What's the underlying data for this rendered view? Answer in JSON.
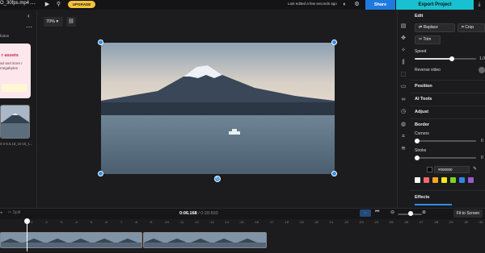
{
  "topbar": {
    "filename": "O_30fps.mp4",
    "more_icon": "ellipsis-icon",
    "upgrade_label": "UPGRADE",
    "last_edited": "Last edited a few seconds ago",
    "share_label": "Share",
    "export_label": "Export Project"
  },
  "left_panel": {
    "photos_label": "hotos",
    "promo": {
      "title": "r assets",
      "text": "ad and store r megabytes"
    },
    "thumb_caption": "0-2-5.6.18_15-18_1..."
  },
  "canvas": {
    "zoom": "70%"
  },
  "right_panel": {
    "edit_heading": "Edit",
    "replace_label": "Replace",
    "crop_label": "Crop",
    "trim_label": "Trim",
    "speed_label": "Speed",
    "speed_value": "1.0",
    "speed_level": 0.6,
    "reverse_label": "Reverse video",
    "sections": {
      "position": "Position",
      "ai_tools": "AI Tools",
      "adjust": "Adjust",
      "border": "Border"
    },
    "corners_label": "Corners",
    "corners_value": "0",
    "stroke_label": "Stroke",
    "stroke_value": "0",
    "color_hex": "#000000",
    "swatches": [
      "#ffffff",
      "#f06a6a",
      "#f5a623",
      "#f8e71c",
      "#7ed321",
      "#2f86e8",
      "#9b59d0"
    ],
    "effects_label": "Effects"
  },
  "timeline": {
    "split_label": "Split",
    "current_time": "0:06.168",
    "total_time": "/ 0:28.893",
    "fit_label": "Fit to Screen",
    "ticks": [
      ":1",
      ":2",
      ":3",
      ":4",
      ":5",
      ":6",
      ":7",
      ":8",
      ":9",
      ":10",
      ":11",
      ":12",
      ":13",
      ":14",
      ":15",
      ":16",
      ":17",
      ":18",
      ":19",
      ":20",
      ":21",
      ":22",
      ":23",
      ":24",
      ":25",
      ":26",
      ":27",
      ":28",
      ":29",
      ":30",
      ":31",
      ":32"
    ]
  }
}
